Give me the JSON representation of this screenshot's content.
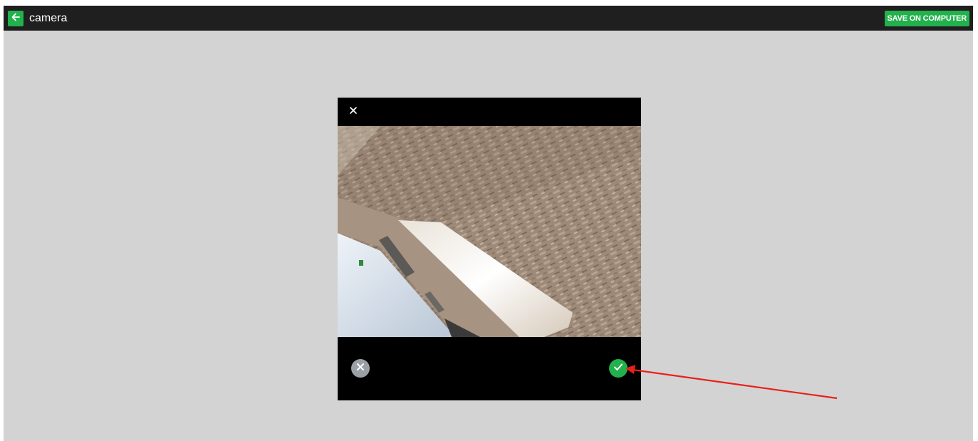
{
  "header": {
    "title": "camera",
    "back_icon": "arrow-left-icon",
    "save_label": "SAVE ON COMPUTER"
  },
  "dialog": {
    "close_icon": "close-icon",
    "photo": "captured-photo",
    "cancel_icon": "cancel-circle-icon",
    "confirm_icon": "check-circle-icon"
  },
  "annotation": {
    "type": "red-arrow",
    "target": "confirm-button"
  },
  "colors": {
    "accent_green": "#22b14c",
    "topbar": "#1f1f1f",
    "canvas": "#d3d3d3",
    "dialog": "#000000",
    "cancel_grey": "#9aa0a6",
    "arrow_red": "#e8201a"
  }
}
